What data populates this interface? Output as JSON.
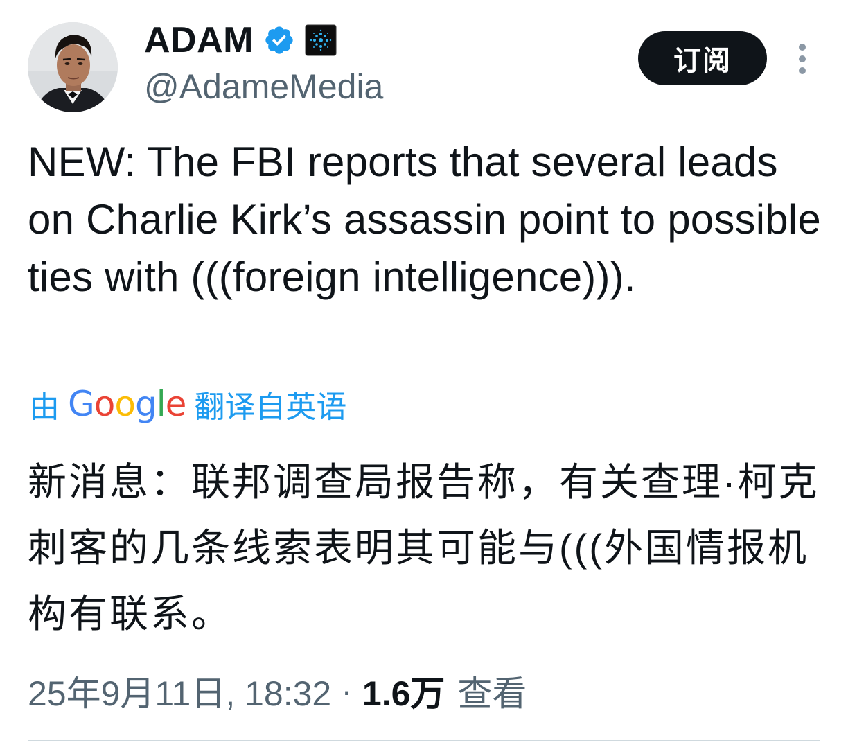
{
  "author": {
    "display_name": "ADAM",
    "handle": "@AdameMedia",
    "verified_icon": "verified-badge-icon",
    "affiliation_icon": "affiliation-badge-icon",
    "avatar": "profile-avatar"
  },
  "actions": {
    "subscribe_label": "订阅",
    "more_icon": "more-vertical-icon"
  },
  "tweet": {
    "text": "NEW: The FBI reports that several leads on Charlie Kirk’s assassin point to possible ties with (((foreign intelligence))).",
    "translation_prefix": "由",
    "translation_provider": "Google",
    "translation_suffix": "翻译自英语",
    "translated_text": "新消息：联邦调查局报告称，有关查理·柯克刺客的几条线索表明其可能与(((外国情报机构有联系。"
  },
  "meta": {
    "timestamp": "25年9月11日, 18:32",
    "separator": "·",
    "view_count": "1.6万",
    "view_label": "查看"
  },
  "colors": {
    "text": "#0f1419",
    "secondary": "#536471",
    "accent": "#1d9bf0",
    "button_bg": "#0f1419"
  }
}
